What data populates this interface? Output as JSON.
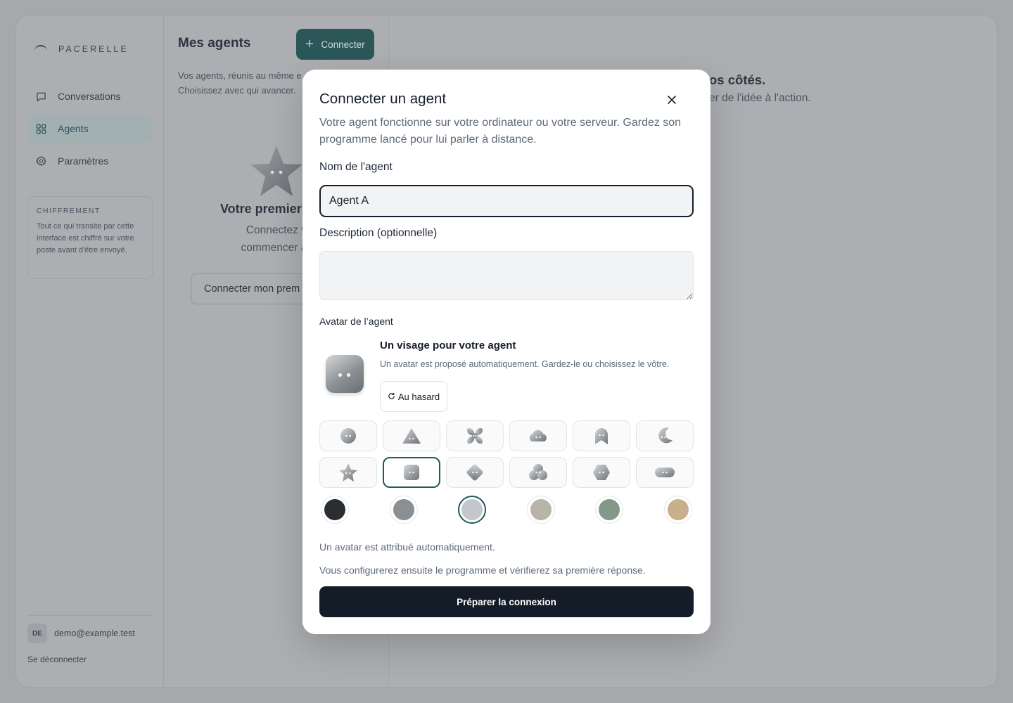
{
  "sidebar": {
    "brand": "PACERELLE",
    "nav": [
      {
        "label": "Conversations",
        "icon": "chat-icon"
      },
      {
        "label": "Agents",
        "icon": "grid-icon",
        "active": true
      },
      {
        "label": "Paramètres",
        "icon": "gear-icon"
      }
    ],
    "encryption": {
      "title": "CHIFFREMENT",
      "text": "Tout ce qui transite par cette interface est chiffré sur votre poste avant d'être envoyé."
    },
    "user": {
      "initials": "DE",
      "email": "demo@example.test"
    },
    "logout_label": "Se déconnecter"
  },
  "agents_panel": {
    "title": "Mes agents",
    "connect_label": "Connecter",
    "subtitle_line1": "Vos agents, réunis au même e",
    "subtitle_line2": "Choisissez avec qui avancer.",
    "empty_title": "Votre premier",
    "empty_sub_line1": "Connectez votre ag",
    "empty_sub_line2": "commencer à échang",
    "empty_button": "Connecter mon prem"
  },
  "main_panel": {
    "title_fragment": "os côtés.",
    "sub_fragment": "er de l'idée à l'action."
  },
  "modal": {
    "title": "Connecter un agent",
    "description": "Votre agent fonctionne sur votre ordinateur ou votre serveur. Gardez son programme lancé pour lui parler à distance.",
    "name_label": "Nom de l'agent",
    "name_value": "Agent A",
    "description_label": "Description (optionnelle)",
    "description_value": "",
    "avatar_section_label": "Avatar de l’agent",
    "avatar_heading": "Un visage pour votre agent",
    "avatar_help": "Un avatar est proposé automatiquement. Gardez-le ou choisissez le vôtre.",
    "random_label": "Au hasard",
    "shapes": [
      "blob",
      "triangle",
      "flower",
      "cloud",
      "ghost",
      "moon",
      "star",
      "square",
      "diamond",
      "cluster",
      "hexagon",
      "pill"
    ],
    "selected_shape": "square",
    "colors": [
      "#2a2d31",
      "#8a8f94",
      "#c3c6ca",
      "#b9b4aa",
      "#84988a",
      "#c9b08b"
    ],
    "selected_color": "#c3c6ca",
    "note_auto": "Un avatar est attribué automatiquement.",
    "note_next": "Vous configurerez ensuite le programme et vérifierez sa première réponse.",
    "submit_label": "Préparer la connexion"
  }
}
